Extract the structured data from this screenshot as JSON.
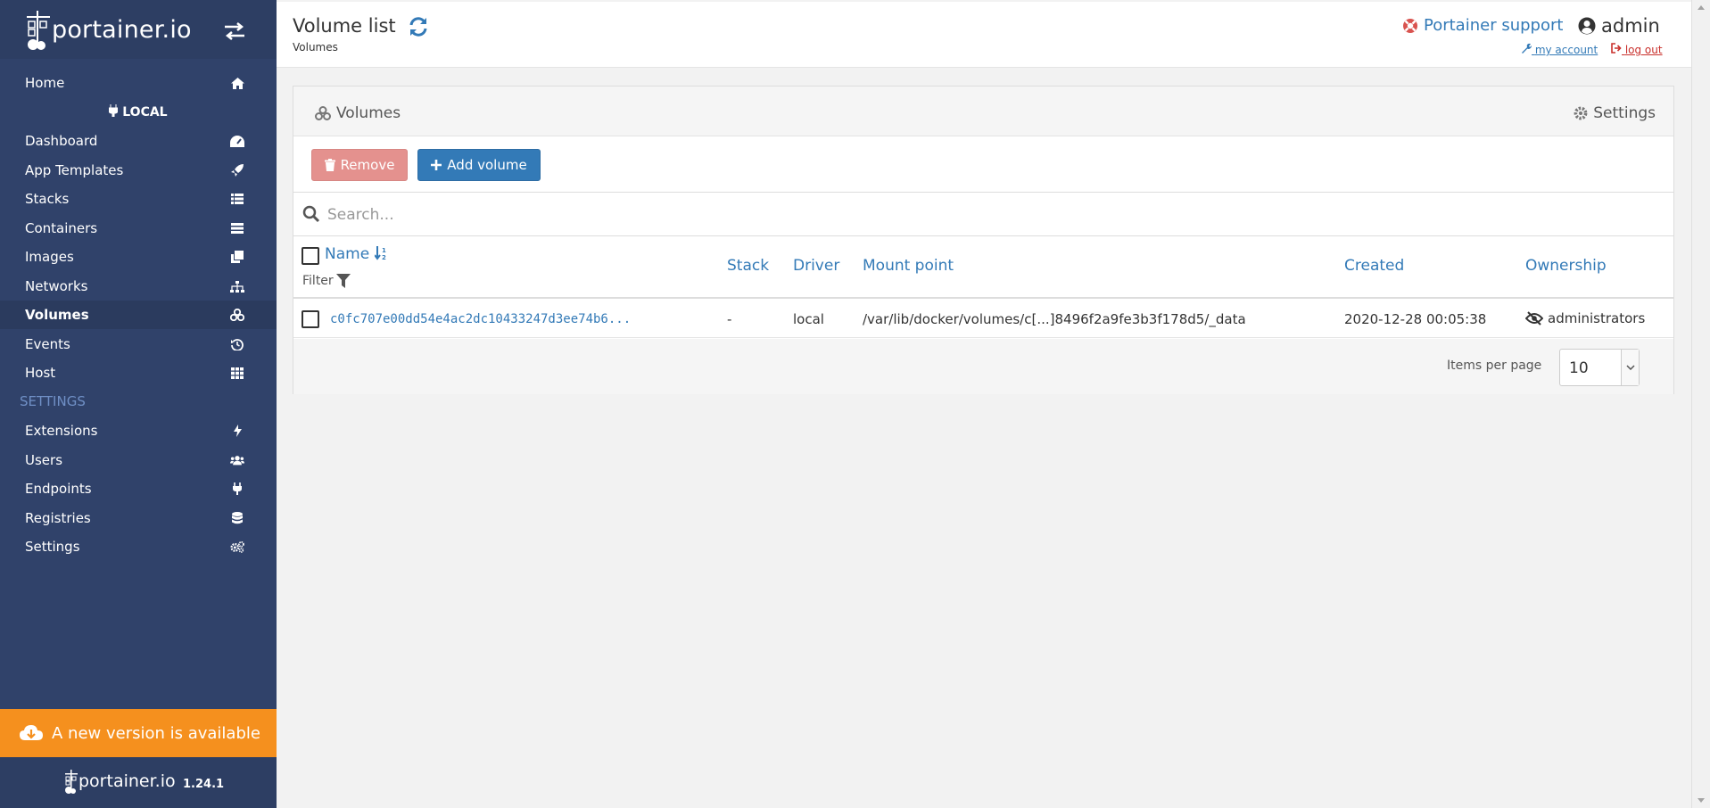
{
  "app": {
    "logo_text": "portainer.io",
    "version": "1.24.1"
  },
  "sidebar": {
    "home": "Home",
    "endpoint": "LOCAL",
    "items": [
      {
        "label": "Dashboard",
        "icon": "tachometer-icon"
      },
      {
        "label": "App Templates",
        "icon": "rocket-icon"
      },
      {
        "label": "Stacks",
        "icon": "th-list-icon"
      },
      {
        "label": "Containers",
        "icon": "server-icon"
      },
      {
        "label": "Images",
        "icon": "clone-icon"
      },
      {
        "label": "Networks",
        "icon": "sitemap-icon"
      },
      {
        "label": "Volumes",
        "icon": "cubes-icon",
        "active": true
      },
      {
        "label": "Events",
        "icon": "history-icon"
      },
      {
        "label": "Host",
        "icon": "th-icon"
      }
    ],
    "settings_title": "SETTINGS",
    "settings_items": [
      {
        "label": "Extensions",
        "icon": "bolt-icon"
      },
      {
        "label": "Users",
        "icon": "users-icon"
      },
      {
        "label": "Endpoints",
        "icon": "plug-icon"
      },
      {
        "label": "Registries",
        "icon": "database-icon"
      },
      {
        "label": "Settings",
        "icon": "cogs-icon"
      }
    ],
    "update_banner": "A new version is available"
  },
  "header": {
    "title": "Volume list",
    "breadcrumb": "Volumes",
    "support": "Portainer support",
    "user": "admin",
    "my_account": "my account",
    "log_out": "log out"
  },
  "widget": {
    "title": "Volumes",
    "settings": "Settings",
    "remove_label": "Remove",
    "add_label": "Add volume",
    "search_placeholder": "Search...",
    "columns": {
      "name": "Name",
      "filter": "Filter",
      "stack": "Stack",
      "driver": "Driver",
      "mount": "Mount point",
      "created": "Created",
      "ownership": "Ownership"
    },
    "rows": [
      {
        "name": "c0fc707e00dd54e4ac2dc10433247d3ee74b6...",
        "stack": "-",
        "driver": "local",
        "mount": "/var/lib/docker/volumes/c[...]8496f2a9fe3b3f178d5/_data",
        "created": "2020-12-28 00:05:38",
        "ownership": "administrators"
      }
    ],
    "items_per_page_label": "Items per page",
    "items_per_page": "10"
  },
  "colors": {
    "sidebar_bg": "#30426a",
    "accent": "#337ab7",
    "banner": "#f5901e",
    "danger": "#e4918e"
  }
}
